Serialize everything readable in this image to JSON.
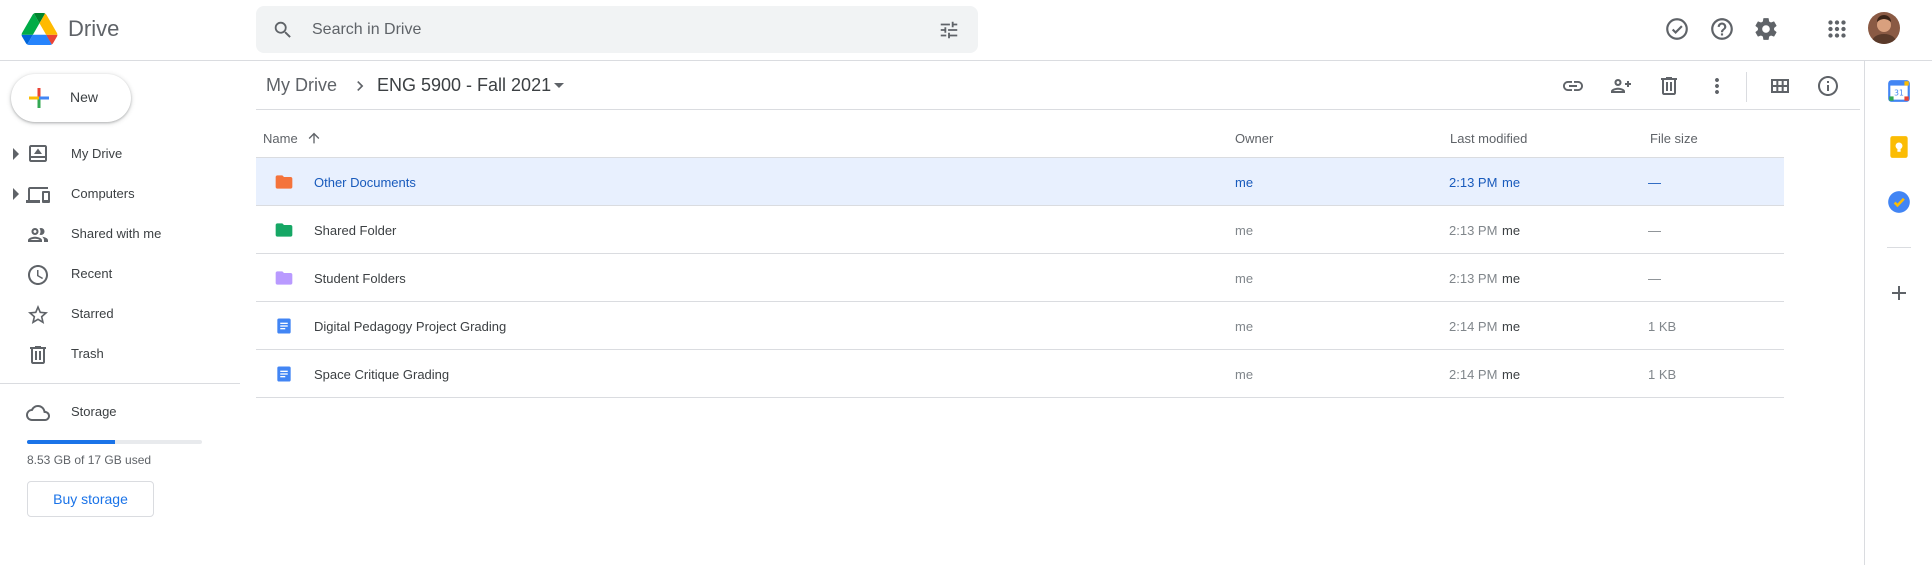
{
  "app": {
    "name": "Drive"
  },
  "search": {
    "placeholder": "Search in Drive"
  },
  "new_button": {
    "label": "New"
  },
  "sidebar": {
    "items": [
      {
        "label": "My Drive",
        "icon": "my-drive-icon",
        "expandable": true
      },
      {
        "label": "Computers",
        "icon": "computers-icon",
        "expandable": true
      },
      {
        "label": "Shared with me",
        "icon": "shared-with-me-icon",
        "expandable": false
      },
      {
        "label": "Recent",
        "icon": "recent-icon",
        "expandable": false
      },
      {
        "label": "Starred",
        "icon": "star-icon",
        "expandable": false
      },
      {
        "label": "Trash",
        "icon": "trash-icon",
        "expandable": false
      }
    ],
    "storage": {
      "label": "Storage",
      "used_text": "8.53 GB of 17 GB used",
      "used_fraction": 0.5,
      "buy_label": "Buy storage"
    }
  },
  "breadcrumb": {
    "root": "My Drive",
    "current": "ENG 5900 - Fall 2021"
  },
  "table": {
    "headers": {
      "name": "Name",
      "owner": "Owner",
      "modified": "Last modified",
      "size": "File size"
    },
    "rows": [
      {
        "name": "Other Documents",
        "type": "folder",
        "color": "#f4733b",
        "owner": "me",
        "time": "2:13 PM",
        "by": "me",
        "size": "—",
        "selected": true
      },
      {
        "name": "Shared Folder",
        "type": "folder",
        "color": "#16a765",
        "owner": "me",
        "time": "2:13 PM",
        "by": "me",
        "size": "—",
        "selected": false
      },
      {
        "name": "Student Folders",
        "type": "folder",
        "color": "#b99aff",
        "owner": "me",
        "time": "2:13 PM",
        "by": "me",
        "size": "—",
        "selected": false
      },
      {
        "name": "Digital Pedagogy Project Grading",
        "type": "doc",
        "color": "#4285f4",
        "owner": "me",
        "time": "2:14 PM",
        "by": "me",
        "size": "1 KB",
        "selected": false
      },
      {
        "name": "Space Critique Grading",
        "type": "doc",
        "color": "#4285f4",
        "owner": "me",
        "time": "2:14 PM",
        "by": "me",
        "size": "1 KB",
        "selected": false
      }
    ]
  },
  "colors": {
    "accent": "#1a73e8",
    "selected_row": "#e8f0fe"
  }
}
